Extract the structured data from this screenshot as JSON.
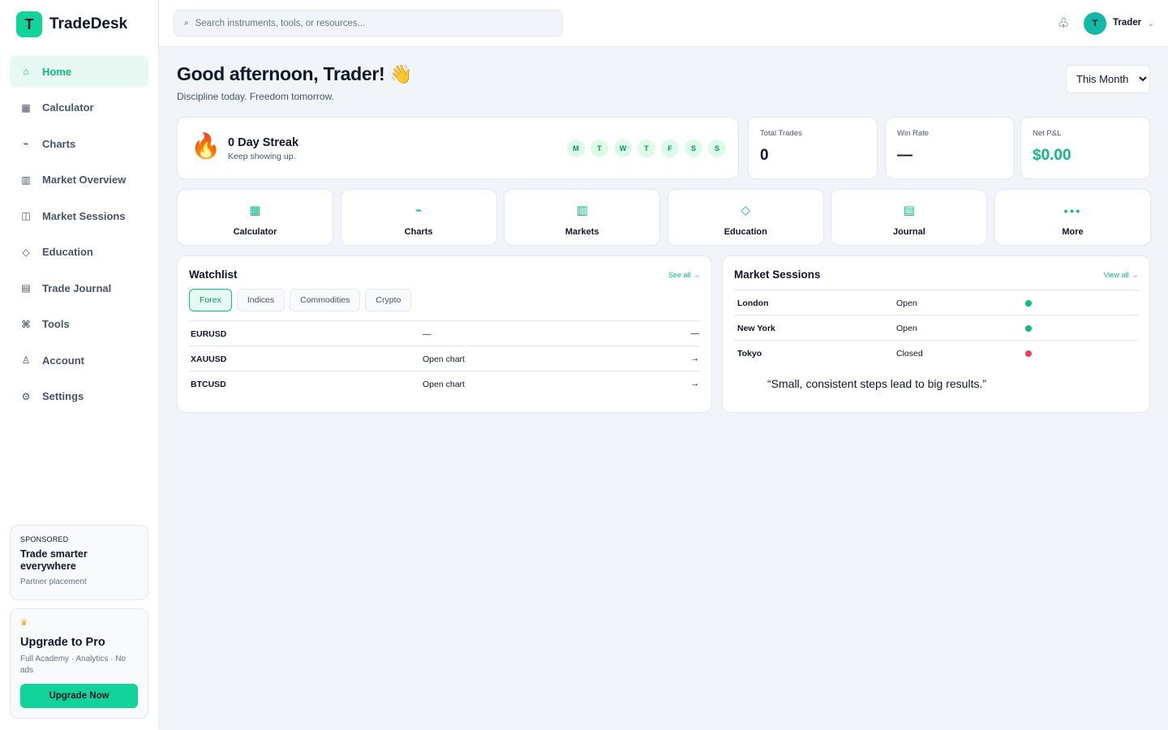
{
  "brand": {
    "logo_letter": "T",
    "name": "TradeDesk",
    "accent": "#12d39a"
  },
  "nav": [
    {
      "label": "Home",
      "icon": "⌂",
      "icon_name": "home-icon",
      "active": true
    },
    {
      "label": "Calculator",
      "icon": "▦",
      "icon_name": "calculator-icon"
    },
    {
      "label": "Charts",
      "icon": "⌁",
      "icon_name": "chart-icon"
    },
    {
      "label": "Market Overview",
      "icon": "▥",
      "icon_name": "market-icon"
    },
    {
      "label": "Market Sessions",
      "icon": "◫",
      "icon_name": "sessions-icon"
    },
    {
      "label": "Education",
      "icon": "◇",
      "icon_name": "education-icon"
    },
    {
      "label": "Trade Journal",
      "icon": "▤",
      "icon_name": "journal-icon"
    },
    {
      "label": "Tools",
      "icon": "⌘",
      "icon_name": "tools-icon"
    },
    {
      "label": "Account",
      "icon": "♙",
      "icon_name": "account-icon"
    },
    {
      "label": "Settings",
      "icon": "⚙",
      "icon_name": "gear-icon"
    }
  ],
  "sponsor": {
    "tag": "SPONSORED",
    "title": "Trade smarter everywhere",
    "sub": "Partner placement"
  },
  "upgrade": {
    "icon": "♛",
    "title": "Upgrade to Pro",
    "sub": "Full Academy · Analytics · No ads",
    "button": "Upgrade Now"
  },
  "header": {
    "search_placeholder": "Search instruments, tools, or resources...",
    "search_icon": "⌕",
    "bell_icon": "♧",
    "avatar_letter": "T",
    "user_name": "Trader",
    "caret": "⌄"
  },
  "main": {
    "greeting": "Good afternoon, Trader! 👋",
    "tagline": "Discipline today. Freedom tomorrow.",
    "period": {
      "selected": "This Month",
      "options": [
        "This Month"
      ]
    },
    "streak": {
      "icon": "🔥",
      "title": "0 Day Streak",
      "sub": "Keep showing up.",
      "days": [
        "M",
        "T",
        "W",
        "T",
        "F",
        "S",
        "S"
      ]
    },
    "stats": [
      {
        "label": "Total Trades",
        "value": "0"
      },
      {
        "label": "Win Rate",
        "value": "—"
      },
      {
        "label": "Net P&L",
        "value": "$0.00",
        "color": "#10b981"
      }
    ],
    "tiles": [
      {
        "label": "Calculator",
        "icon": "▦",
        "icon_name": "calculator-icon"
      },
      {
        "label": "Charts",
        "icon": "⌁",
        "icon_name": "chart-icon"
      },
      {
        "label": "Markets",
        "icon": "▥",
        "icon_name": "market-icon"
      },
      {
        "label": "Education",
        "icon": "◇",
        "icon_name": "education-icon"
      },
      {
        "label": "Journal",
        "icon": "▤",
        "icon_name": "journal-icon"
      },
      {
        "label": "More",
        "icon": "●●●",
        "icon_name": "more-icon"
      }
    ],
    "watchlist": {
      "title": "Watchlist",
      "link": "See all →",
      "filters": [
        "Forex",
        "Indices",
        "Commodities",
        "Crypto"
      ],
      "active_filter": "Forex",
      "rows": [
        {
          "symbol": "EURUSD",
          "mid": "—",
          "end": "—"
        },
        {
          "symbol": "XAUUSD",
          "mid": "Open chart",
          "end": "→"
        },
        {
          "symbol": "BTCUSD",
          "mid": "Open chart",
          "end": "→"
        }
      ]
    },
    "sessions": {
      "title": "Market Sessions",
      "link": "View all →",
      "rows": [
        {
          "name": "London",
          "state": "Open",
          "color": "#10b981"
        },
        {
          "name": "New York",
          "state": "Open",
          "color": "#10b981"
        },
        {
          "name": "Tokyo",
          "state": "Closed",
          "color": "#f43f5e"
        }
      ],
      "quote": "“Small, consistent steps lead to big results.”"
    }
  }
}
